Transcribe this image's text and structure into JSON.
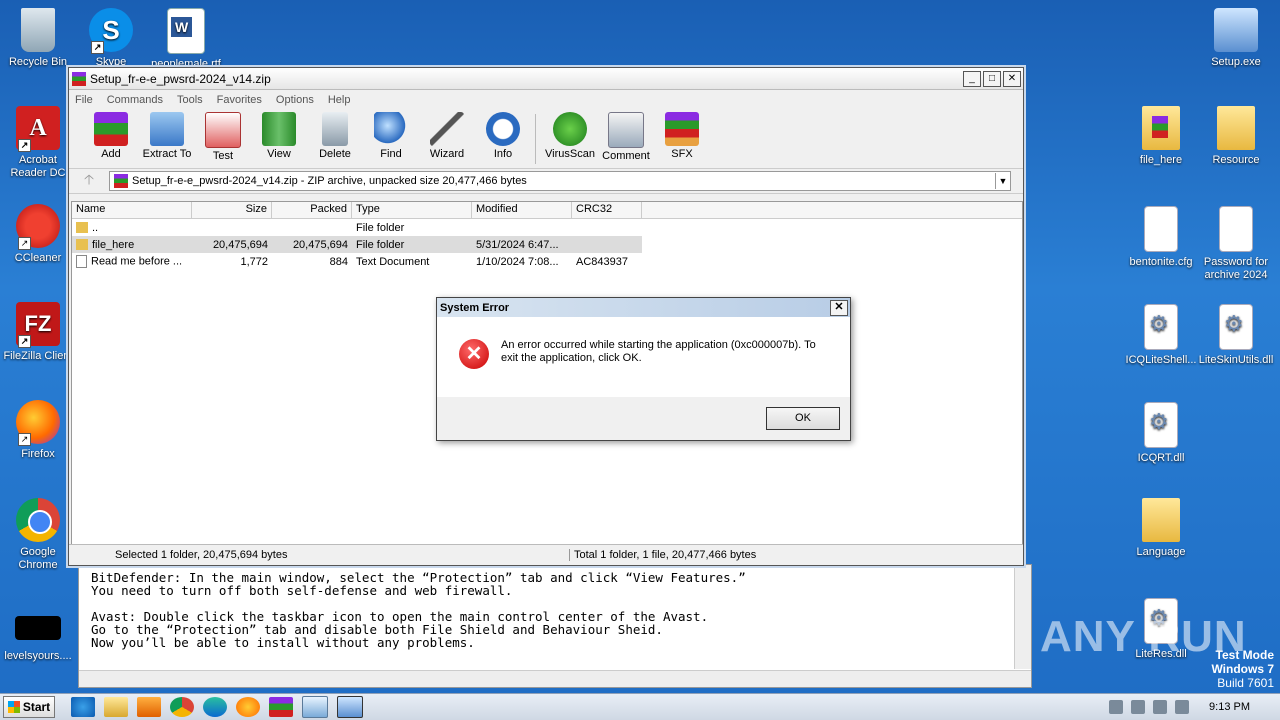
{
  "desktop": {
    "left_icons": [
      {
        "label": "Recycle Bin"
      },
      {
        "label": "Skype"
      },
      {
        "label": "peoplemale.rtf"
      },
      {
        "label": "Acrobat Reader DC"
      },
      {
        "label": "CCleaner"
      },
      {
        "label": "FileZilla Client"
      },
      {
        "label": "Firefox"
      },
      {
        "label": "Google Chrome"
      },
      {
        "label": "levelsyours...."
      }
    ],
    "right_icons": [
      {
        "label": "Setup.exe"
      },
      {
        "label": "file_here"
      },
      {
        "label": "Resource"
      },
      {
        "label": "bentonite.cfg"
      },
      {
        "label": "Password for archive 2024"
      },
      {
        "label": "ICQLiteShell..."
      },
      {
        "label": "LiteSkinUtils.dll"
      },
      {
        "label": "ICQRT.dll"
      },
      {
        "label": "Language"
      },
      {
        "label": "LiteRes.dll"
      }
    ],
    "watermark": "ANY RUN",
    "test_mode": {
      "line1": "Test Mode",
      "line2": "Windows 7",
      "line3": "Build 7601"
    }
  },
  "winrar": {
    "title": "Setup_fr-e-e_pwsrd-2024_v14.zip",
    "menu": [
      "File",
      "Commands",
      "Tools",
      "Favorites",
      "Options",
      "Help"
    ],
    "toolbar": [
      "Add",
      "Extract To",
      "Test",
      "View",
      "Delete",
      "Find",
      "Wizard",
      "Info",
      "VirusScan",
      "Comment",
      "SFX"
    ],
    "address": "Setup_fr-e-e_pwsrd-2024_v14.zip - ZIP archive, unpacked size 20,477,466 bytes",
    "columns": [
      "Name",
      "Size",
      "Packed",
      "Type",
      "Modified",
      "CRC32"
    ],
    "rows": [
      {
        "name": "..",
        "size": "",
        "packed": "",
        "type": "File folder",
        "modified": "",
        "crc": ""
      },
      {
        "name": "file_here",
        "size": "20,475,694",
        "packed": "20,475,694",
        "type": "File folder",
        "modified": "5/31/2024 6:47...",
        "crc": ""
      },
      {
        "name": "Read me before ...",
        "size": "1,772",
        "packed": "884",
        "type": "Text Document",
        "modified": "1/10/2024 7:08...",
        "crc": "AC843937"
      }
    ],
    "status_left": "Selected 1 folder, 20,475,694 bytes",
    "status_right": "Total 1 folder, 1 file, 20,477,466 bytes"
  },
  "notepad": {
    "lines": [
      "BitDefender: In the main window, select the “Protection” tab and click “View Features.”",
      "You need to turn off both self-defense and web firewall.",
      "",
      "Avast: Double click the taskbar icon to open the main control center of the Avast.",
      "Go to the “Protection” tab and disable both File Shield and Behaviour Sheid.",
      "Now you’ll be able to install without any problems."
    ]
  },
  "dialog": {
    "title": "System Error",
    "message": "An error occurred while starting the application (0xc000007b). To exit the application, click OK.",
    "ok_label": "OK"
  },
  "taskbar": {
    "start_label": "Start",
    "clock": "9:13 PM"
  }
}
